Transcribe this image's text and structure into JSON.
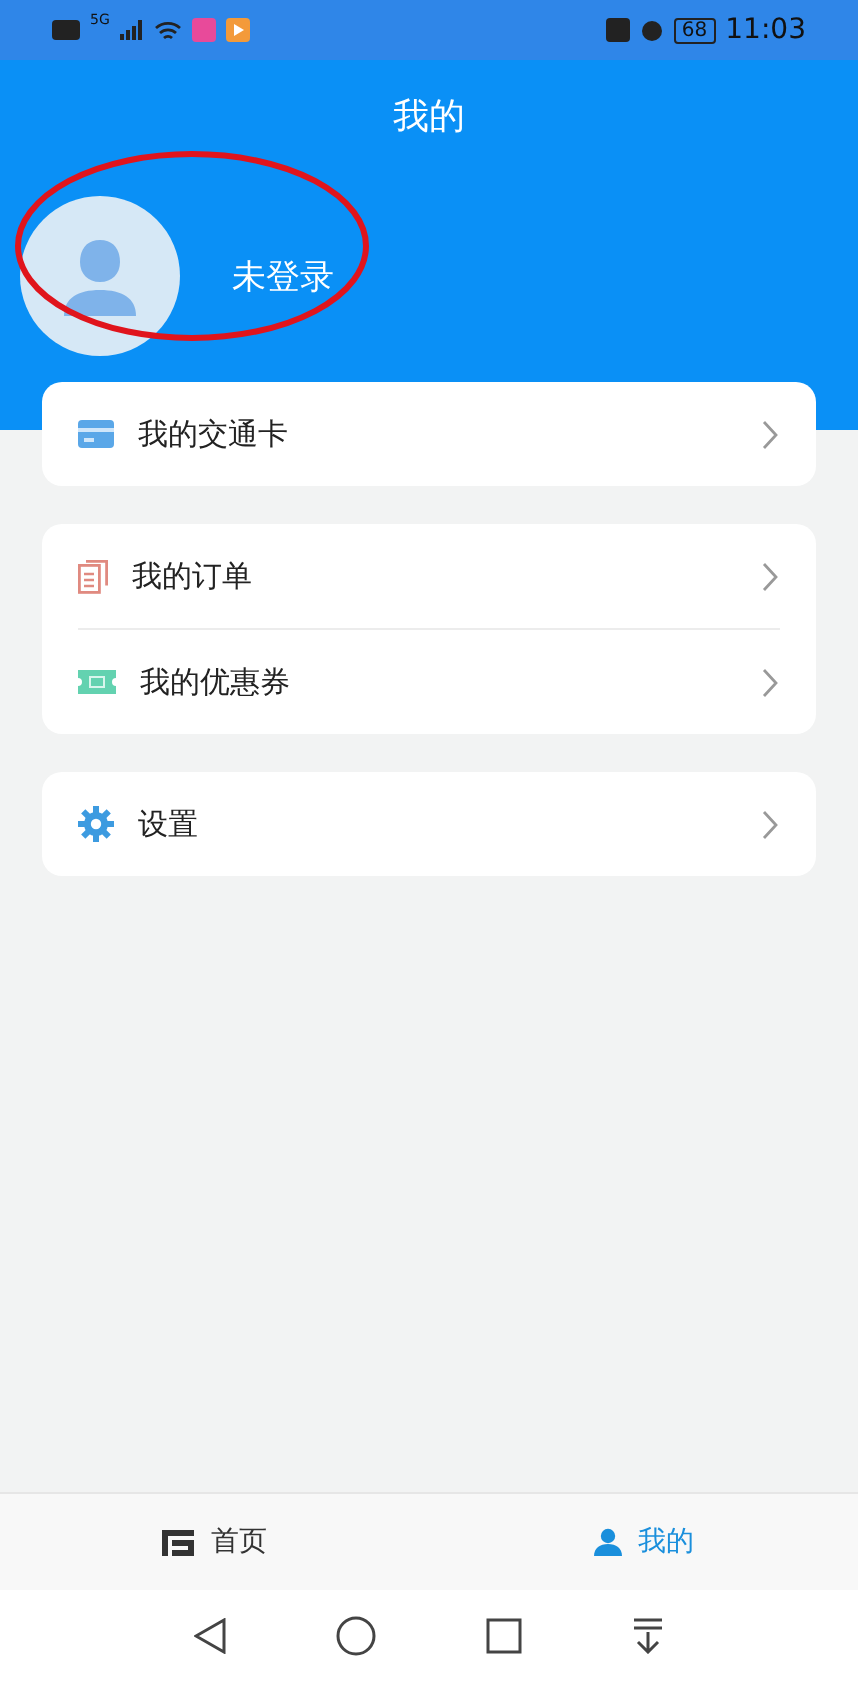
{
  "status_bar": {
    "network": "5G",
    "battery": "68",
    "time": "11:03"
  },
  "header": {
    "title": "我的"
  },
  "profile": {
    "name": "未登录",
    "annotated": true
  },
  "menu_groups": [
    {
      "items": [
        {
          "kind": "card",
          "label": "我的交通卡"
        }
      ]
    },
    {
      "items": [
        {
          "kind": "order",
          "label": "我的订单"
        },
        {
          "kind": "coupon",
          "label": "我的优惠券"
        }
      ]
    },
    {
      "items": [
        {
          "kind": "settings",
          "label": "设置"
        }
      ]
    }
  ],
  "tab_bar": [
    {
      "kind": "home",
      "label": "首页",
      "selected": false
    },
    {
      "kind": "me",
      "label": "我的",
      "selected": true
    }
  ]
}
